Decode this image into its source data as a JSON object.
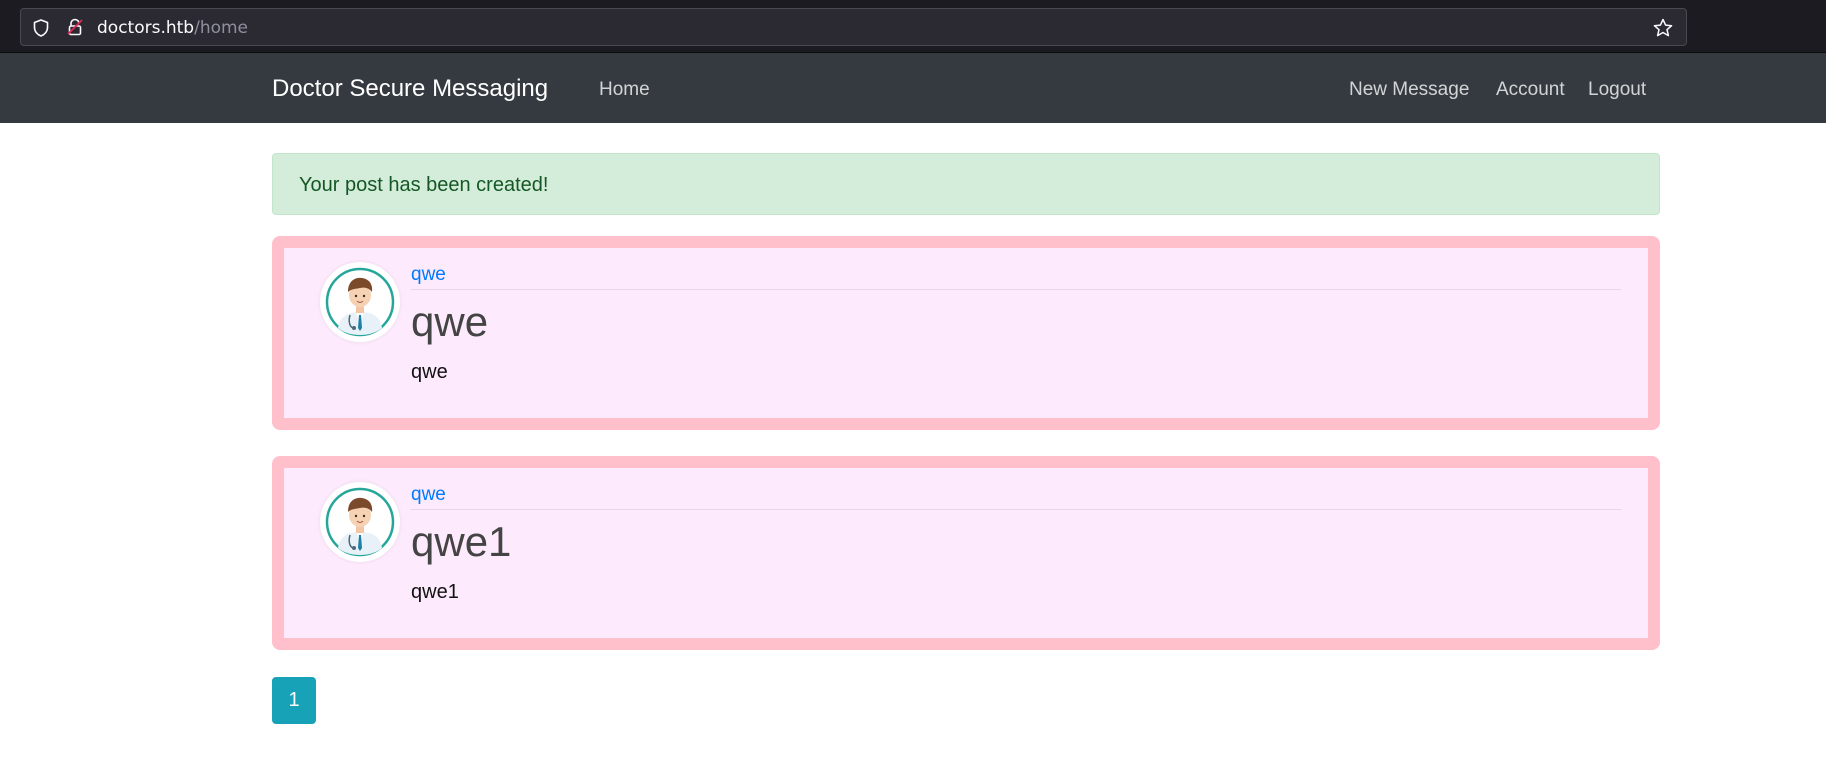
{
  "browser": {
    "url_host": "doctors.htb",
    "url_path": "/home"
  },
  "navbar": {
    "brand": "Doctor Secure Messaging",
    "home": "Home",
    "new_message": "New Message",
    "account": "Account",
    "logout": "Logout"
  },
  "alert": {
    "message": "Your post has been created!",
    "color": "#155724"
  },
  "posts": [
    {
      "author": "qwe",
      "title": "qwe",
      "content": "qwe"
    },
    {
      "author": "qwe",
      "title": "qwe1",
      "content": "qwe1"
    }
  ],
  "pagination": {
    "current_page": "1"
  },
  "colors": {
    "navbar": "#343a40",
    "post_border": "#ffc0cb",
    "post_bg": "#fdeafc",
    "link": "#007bff",
    "page_button": "#17a2b8"
  },
  "icons": [
    "shield-icon",
    "lock-icon",
    "star-icon",
    "doctor-avatar"
  ]
}
